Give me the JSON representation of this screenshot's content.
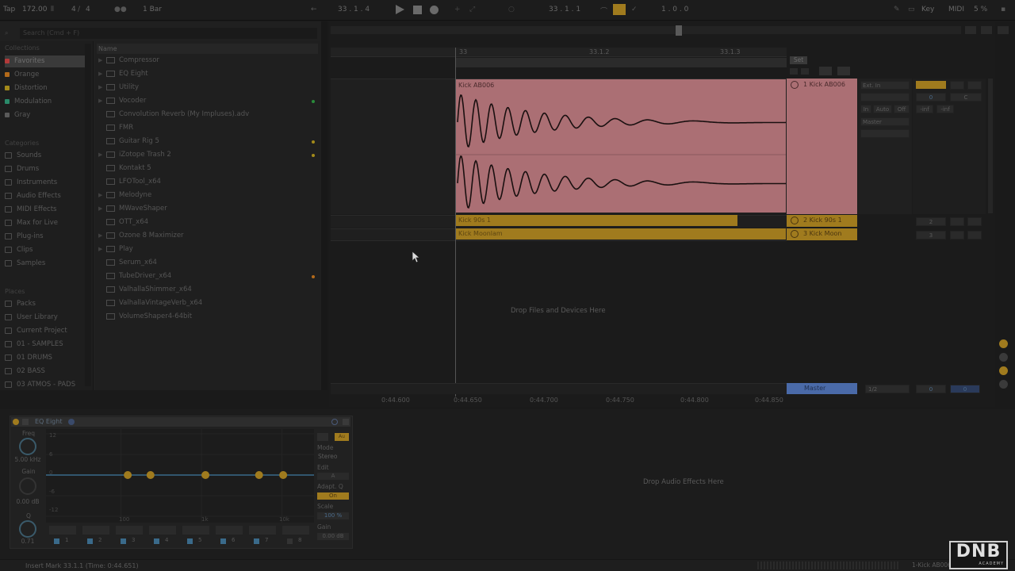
{
  "transport": {
    "tap": "Tap",
    "tempo": "172.00",
    "meter_num": "4",
    "meter_den": "4",
    "quantize": "1 Bar",
    "position": "33 .  1 .  4",
    "loop_start": "33 .  1 .  1",
    "loop_length": "1 .  0 .  0",
    "key_label": "Key",
    "midi_label": "MIDI",
    "cpu": "5 %"
  },
  "browser": {
    "search_placeholder": "Search (Cmd + F)",
    "collections_label": "Collections",
    "collections": [
      {
        "label": "Favorites",
        "color": "#b23a3a"
      },
      {
        "label": "Orange",
        "color": "#b36a1a"
      },
      {
        "label": "Distortion",
        "color": "#a38a1a"
      },
      {
        "label": "Modulation",
        "color": "#2a8a6a"
      },
      {
        "label": "Gray",
        "color": "#5a5a5a"
      }
    ],
    "categories_label": "Categories",
    "categories": [
      "Sounds",
      "Drums",
      "Instruments",
      "Audio Effects",
      "MIDI Effects",
      "Max for Live",
      "Plug-ins",
      "Clips",
      "Samples"
    ],
    "places_label": "Places",
    "places": [
      "Packs",
      "User Library",
      "Current Project",
      "01 - SAMPLES",
      "01 DRUMS",
      "02 BASS",
      "03 ATMOS - PADS"
    ],
    "list_header": "Name",
    "items": [
      {
        "label": "Compressor",
        "arrow": true,
        "mark": ""
      },
      {
        "label": "EQ Eight",
        "arrow": true,
        "mark": ""
      },
      {
        "label": "Utility",
        "arrow": true,
        "mark": ""
      },
      {
        "label": "Vocoder",
        "arrow": true,
        "mark": "#2a8a3a"
      },
      {
        "label": "Convolution Reverb (My Impluses).adv",
        "arrow": false,
        "mark": ""
      },
      {
        "label": "FMR",
        "arrow": false,
        "mark": ""
      },
      {
        "label": "Guitar Rig 5",
        "arrow": false,
        "mark": "#a38a1a"
      },
      {
        "label": "iZotope Trash 2",
        "arrow": true,
        "mark": "#a38a1a"
      },
      {
        "label": "Kontakt 5",
        "arrow": false,
        "mark": ""
      },
      {
        "label": "LFOTool_x64",
        "arrow": false,
        "mark": ""
      },
      {
        "label": "Melodyne",
        "arrow": true,
        "mark": ""
      },
      {
        "label": "MWaveShaper",
        "arrow": true,
        "mark": ""
      },
      {
        "label": "OTT_x64",
        "arrow": false,
        "mark": ""
      },
      {
        "label": "Ozone 8 Maximizer",
        "arrow": true,
        "mark": ""
      },
      {
        "label": "Play",
        "arrow": true,
        "mark": ""
      },
      {
        "label": "Serum_x64",
        "arrow": false,
        "mark": ""
      },
      {
        "label": "TubeDriver_x64",
        "arrow": false,
        "mark": "#b36a1a"
      },
      {
        "label": "ValhallaShimmer_x64",
        "arrow": false,
        "mark": ""
      },
      {
        "label": "ValhallaVintageVerb_x64",
        "arrow": false,
        "mark": ""
      },
      {
        "label": "VolumeShaper4-64bit",
        "arrow": false,
        "mark": ""
      }
    ]
  },
  "arrangement": {
    "ruler": [
      "33",
      "33.1.2",
      "33.1.3"
    ],
    "set_label": "Set",
    "clips": {
      "main": "Kick AB006",
      "clip2": "Kick 90s 1",
      "clip3": "Kick Moonlam"
    },
    "tracks": [
      {
        "name": "1 Kick AB006"
      },
      {
        "name": "2 Kick 90s 1"
      },
      {
        "name": "3 Kick Moon"
      }
    ],
    "io": {
      "input": "Ext. In",
      "output": "Master",
      "vol": "0",
      "pan": "C",
      "in_label": "In",
      "auto_label": "Auto",
      "off_label": "Off",
      "inf1": "-inf",
      "inf2": "-inf",
      "t2_num": "2",
      "t3_num": "3"
    },
    "drop_files": "Drop Files and Devices Here",
    "master_label": "Master",
    "master_quant": "1/2",
    "master_vol": "0",
    "master_pan": "0",
    "timeline": [
      "0:44.600",
      "0:44.650",
      "0:44.700",
      "0:44.750",
      "0:44.800",
      "0:44.850"
    ]
  },
  "eq": {
    "title": "EQ Eight",
    "freq_label": "Freq",
    "freq_value": "5.00 kHz",
    "gain_label": "Gain",
    "gain_value": "0.00 dB",
    "q_label": "Q",
    "q_value": "0.71",
    "db_scale": [
      "12",
      "6",
      "0",
      "-6",
      "-12"
    ],
    "freq_scale": [
      "100",
      "1k",
      "10k"
    ],
    "mode_label": "Mode",
    "mode_value": "Stereo",
    "edit_label": "Edit",
    "edit_value": "A",
    "adapt_label": "Adapt. Q",
    "adapt_value": "On",
    "scale_label": "Scale",
    "scale_value": "100 %",
    "gain2_label": "Gain",
    "gain2_value": "0.00 dB",
    "bands": [
      "1",
      "2",
      "3",
      "4",
      "5",
      "6",
      "7",
      "8"
    ],
    "au_label": "Au",
    "points": [
      0.305,
      0.39,
      0.595,
      0.795,
      0.885
    ]
  },
  "drop_effects": "Drop Audio Effects Here",
  "status": {
    "text": "Insert Mark 33.1.1 (Time: 0:44.651)",
    "track": "1-Kick AB006"
  },
  "logo": {
    "big": "DNB",
    "small": "ACADEMY"
  }
}
